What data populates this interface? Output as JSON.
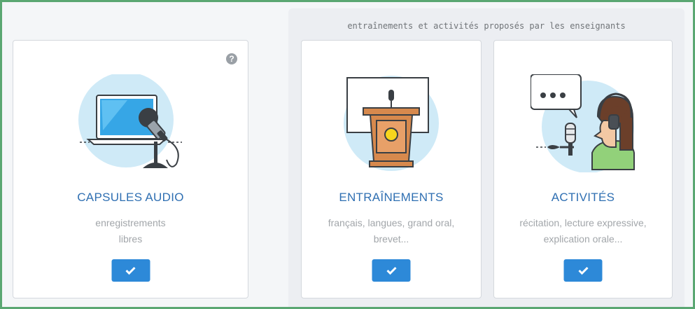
{
  "header": {
    "teacher_note": "entraînements et activités proposés par les enseignants"
  },
  "cards": [
    {
      "title": "CAPSULES AUDIO",
      "desc_line1": "enregistrements",
      "desc_line2": "libres",
      "help_glyph": "?",
      "icon": "laptop-microphone-icon"
    },
    {
      "title": "ENTRAÎNEMENTS",
      "desc_line1": "français, langues, grand oral,",
      "desc_line2": "brevet...",
      "icon": "podium-icon"
    },
    {
      "title": "ACTIVITÉS",
      "desc_line1": "récitation, lecture expressive,",
      "desc_line2": "explication orale...",
      "icon": "speaker-headset-icon"
    }
  ],
  "colors": {
    "accent": "#2d89d8",
    "title": "#2f6fb2",
    "frame": "#5aa772"
  }
}
